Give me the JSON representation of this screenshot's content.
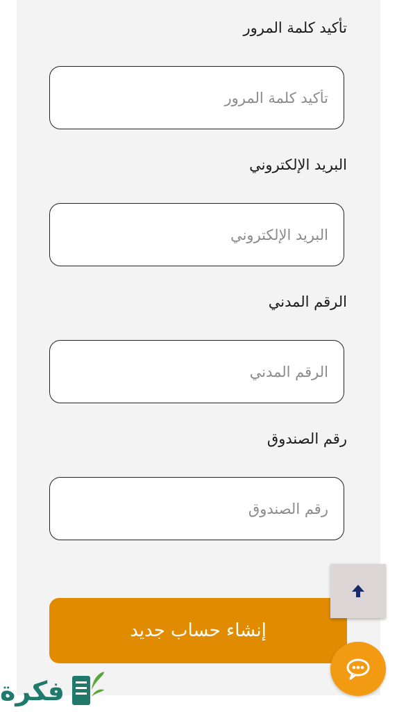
{
  "form": {
    "confirm_password": {
      "label": "تأكيد كلمة المرور",
      "placeholder": "تأكيد كلمة المرور"
    },
    "email": {
      "label": "البريد الإلكتروني",
      "placeholder": "البريد الإلكتروني"
    },
    "civil_id": {
      "label": "الرقم المدني",
      "placeholder": "الرقم المدني"
    },
    "po_box": {
      "label": "رقم الصندوق",
      "placeholder": "رقم الصندوق"
    },
    "submit_label": "إنشاء حساب جديد"
  },
  "floating": {
    "scroll_top_icon": "arrow-up-icon",
    "chat_icon": "chat-bubble-icon"
  },
  "watermark": {
    "text": "فكرة"
  },
  "colors": {
    "accent": "#e18b00",
    "chat": "#f19a12",
    "arrow": "#1b2a6b",
    "logo": "#1f7a6c"
  }
}
